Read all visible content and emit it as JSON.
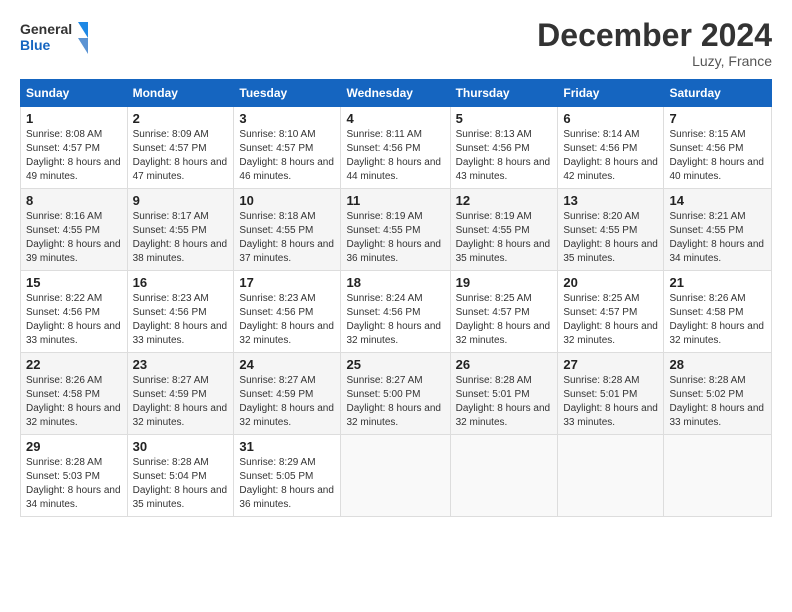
{
  "header": {
    "logo_line1": "General",
    "logo_line2": "Blue",
    "month_title": "December 2024",
    "location": "Luzy, France"
  },
  "columns": [
    "Sunday",
    "Monday",
    "Tuesday",
    "Wednesday",
    "Thursday",
    "Friday",
    "Saturday"
  ],
  "weeks": [
    [
      {
        "day": "1",
        "sunrise": "8:08 AM",
        "sunset": "4:57 PM",
        "daylight": "8 hours and 49 minutes."
      },
      {
        "day": "2",
        "sunrise": "8:09 AM",
        "sunset": "4:57 PM",
        "daylight": "8 hours and 47 minutes."
      },
      {
        "day": "3",
        "sunrise": "8:10 AM",
        "sunset": "4:57 PM",
        "daylight": "8 hours and 46 minutes."
      },
      {
        "day": "4",
        "sunrise": "8:11 AM",
        "sunset": "4:56 PM",
        "daylight": "8 hours and 44 minutes."
      },
      {
        "day": "5",
        "sunrise": "8:13 AM",
        "sunset": "4:56 PM",
        "daylight": "8 hours and 43 minutes."
      },
      {
        "day": "6",
        "sunrise": "8:14 AM",
        "sunset": "4:56 PM",
        "daylight": "8 hours and 42 minutes."
      },
      {
        "day": "7",
        "sunrise": "8:15 AM",
        "sunset": "4:56 PM",
        "daylight": "8 hours and 40 minutes."
      }
    ],
    [
      {
        "day": "8",
        "sunrise": "8:16 AM",
        "sunset": "4:55 PM",
        "daylight": "8 hours and 39 minutes."
      },
      {
        "day": "9",
        "sunrise": "8:17 AM",
        "sunset": "4:55 PM",
        "daylight": "8 hours and 38 minutes."
      },
      {
        "day": "10",
        "sunrise": "8:18 AM",
        "sunset": "4:55 PM",
        "daylight": "8 hours and 37 minutes."
      },
      {
        "day": "11",
        "sunrise": "8:19 AM",
        "sunset": "4:55 PM",
        "daylight": "8 hours and 36 minutes."
      },
      {
        "day": "12",
        "sunrise": "8:19 AM",
        "sunset": "4:55 PM",
        "daylight": "8 hours and 35 minutes."
      },
      {
        "day": "13",
        "sunrise": "8:20 AM",
        "sunset": "4:55 PM",
        "daylight": "8 hours and 35 minutes."
      },
      {
        "day": "14",
        "sunrise": "8:21 AM",
        "sunset": "4:55 PM",
        "daylight": "8 hours and 34 minutes."
      }
    ],
    [
      {
        "day": "15",
        "sunrise": "8:22 AM",
        "sunset": "4:56 PM",
        "daylight": "8 hours and 33 minutes."
      },
      {
        "day": "16",
        "sunrise": "8:23 AM",
        "sunset": "4:56 PM",
        "daylight": "8 hours and 33 minutes."
      },
      {
        "day": "17",
        "sunrise": "8:23 AM",
        "sunset": "4:56 PM",
        "daylight": "8 hours and 32 minutes."
      },
      {
        "day": "18",
        "sunrise": "8:24 AM",
        "sunset": "4:56 PM",
        "daylight": "8 hours and 32 minutes."
      },
      {
        "day": "19",
        "sunrise": "8:25 AM",
        "sunset": "4:57 PM",
        "daylight": "8 hours and 32 minutes."
      },
      {
        "day": "20",
        "sunrise": "8:25 AM",
        "sunset": "4:57 PM",
        "daylight": "8 hours and 32 minutes."
      },
      {
        "day": "21",
        "sunrise": "8:26 AM",
        "sunset": "4:58 PM",
        "daylight": "8 hours and 32 minutes."
      }
    ],
    [
      {
        "day": "22",
        "sunrise": "8:26 AM",
        "sunset": "4:58 PM",
        "daylight": "8 hours and 32 minutes."
      },
      {
        "day": "23",
        "sunrise": "8:27 AM",
        "sunset": "4:59 PM",
        "daylight": "8 hours and 32 minutes."
      },
      {
        "day": "24",
        "sunrise": "8:27 AM",
        "sunset": "4:59 PM",
        "daylight": "8 hours and 32 minutes."
      },
      {
        "day": "25",
        "sunrise": "8:27 AM",
        "sunset": "5:00 PM",
        "daylight": "8 hours and 32 minutes."
      },
      {
        "day": "26",
        "sunrise": "8:28 AM",
        "sunset": "5:01 PM",
        "daylight": "8 hours and 32 minutes."
      },
      {
        "day": "27",
        "sunrise": "8:28 AM",
        "sunset": "5:01 PM",
        "daylight": "8 hours and 33 minutes."
      },
      {
        "day": "28",
        "sunrise": "8:28 AM",
        "sunset": "5:02 PM",
        "daylight": "8 hours and 33 minutes."
      }
    ],
    [
      {
        "day": "29",
        "sunrise": "8:28 AM",
        "sunset": "5:03 PM",
        "daylight": "8 hours and 34 minutes."
      },
      {
        "day": "30",
        "sunrise": "8:28 AM",
        "sunset": "5:04 PM",
        "daylight": "8 hours and 35 minutes."
      },
      {
        "day": "31",
        "sunrise": "8:29 AM",
        "sunset": "5:05 PM",
        "daylight": "8 hours and 36 minutes."
      },
      null,
      null,
      null,
      null
    ]
  ],
  "labels": {
    "sunrise": "Sunrise: ",
    "sunset": "Sunset: ",
    "daylight": "Daylight: "
  }
}
